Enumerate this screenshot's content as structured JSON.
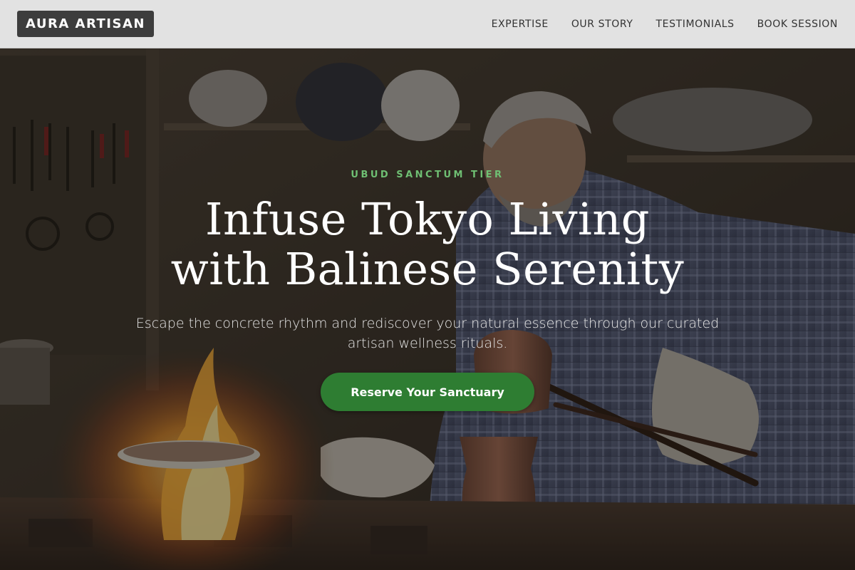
{
  "header": {
    "logo": "AURA ARTISAN",
    "nav": [
      {
        "label": "EXPERTISE"
      },
      {
        "label": "OUR STORY"
      },
      {
        "label": "TESTIMONIALS"
      },
      {
        "label": "BOOK SESSION"
      }
    ]
  },
  "hero": {
    "tier_label": "UBUD SANCTUM TIER",
    "title_line1": "Infuse Tokyo Living",
    "title_line2": "with Balinese Serenity",
    "subtitle": "Escape the concrete rhythm and rediscover your natural essence through our curated artisan wellness rituals.",
    "cta_label": "Reserve Your Sanctuary",
    "background": "artisan coppersmith working over open flame in workshop"
  },
  "colors": {
    "header_bg": "#e2e2e2",
    "logo_bg": "#3d3d3d",
    "accent_green": "#6fbf73",
    "cta_bg": "#2e7d32"
  }
}
